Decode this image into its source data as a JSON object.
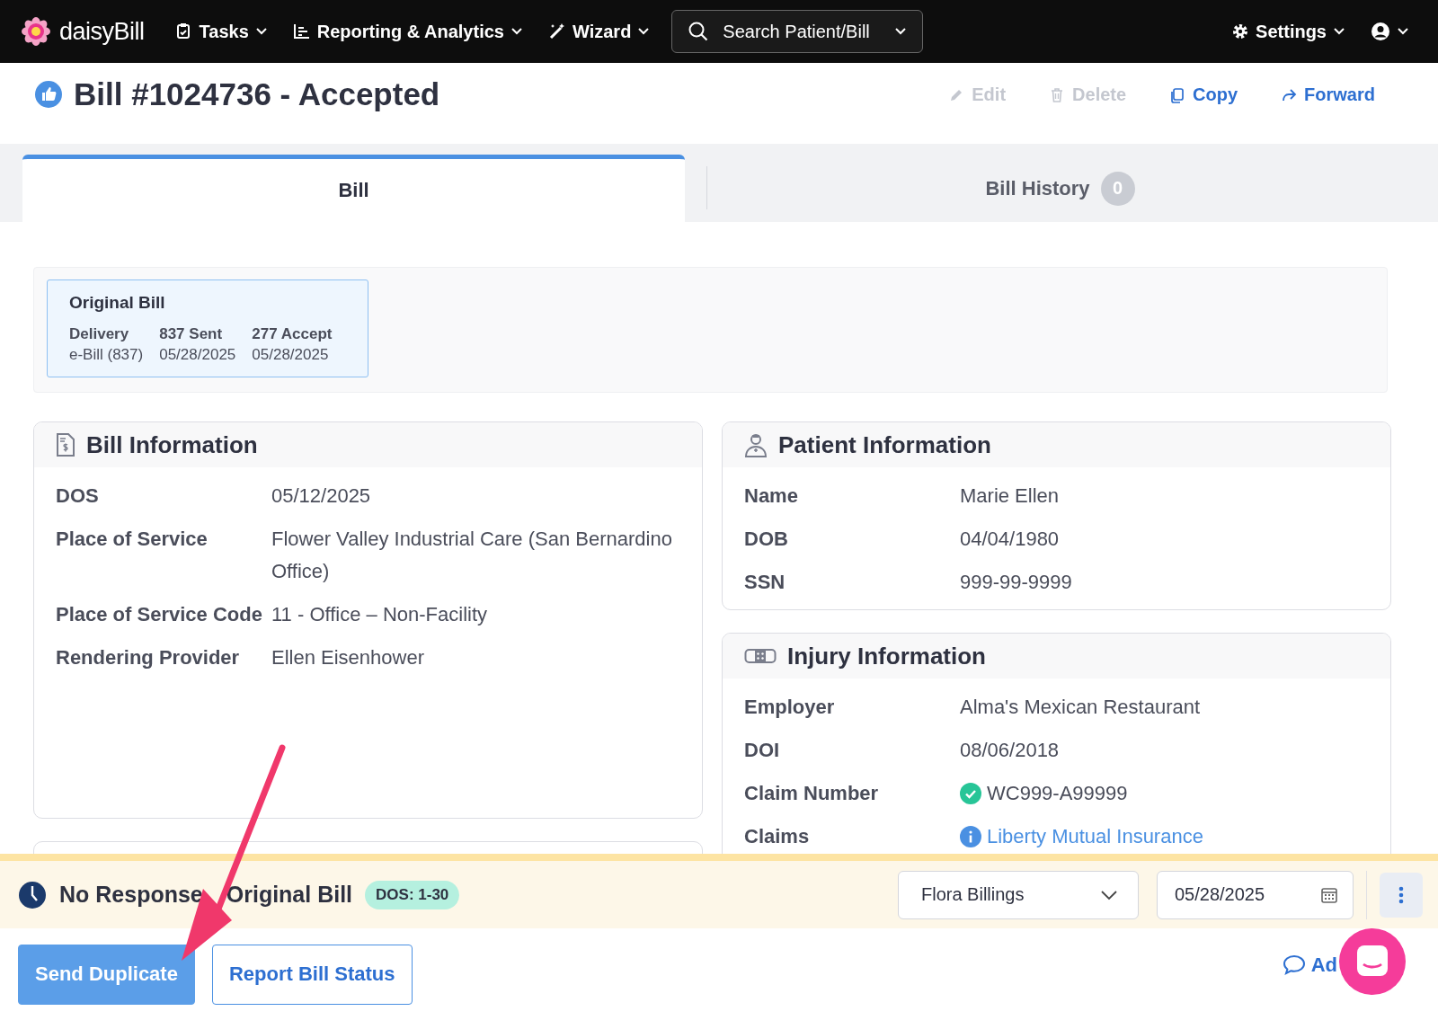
{
  "nav": {
    "logo": "daisyBill",
    "menus": [
      {
        "label": "Tasks",
        "kind": "tasks"
      },
      {
        "label": "Reporting & Analytics",
        "kind": "reports"
      },
      {
        "label": "Wizard",
        "kind": "wizard"
      }
    ],
    "search": {
      "placeholder": "Search Patient/Bill"
    },
    "settings": "Settings"
  },
  "bill_header": {
    "title": "Bill #1024736 - Accepted",
    "actions": [
      {
        "label": "Edit",
        "kind": "edit",
        "disabled": true
      },
      {
        "label": "Delete",
        "kind": "delete",
        "disabled": true
      },
      {
        "label": "Copy",
        "kind": "copy",
        "disabled": false
      },
      {
        "label": "Forward",
        "kind": "forward",
        "disabled": false
      }
    ]
  },
  "tabs": [
    {
      "label": "Bill",
      "selected": true
    },
    {
      "label": "Bill History",
      "selected": false,
      "count": "0"
    }
  ],
  "original_bill": {
    "title": "Original Bill",
    "columns": [
      {
        "heading": "Delivery",
        "value": "e-Bill (837)"
      },
      {
        "heading": "837 Sent",
        "value": "05/28/2025"
      },
      {
        "heading": "277 Accept",
        "value": "05/28/2025"
      }
    ]
  },
  "left_cards": [
    {
      "kind": "bill",
      "title": "Bill Information",
      "rows": [
        {
          "label": "DOS",
          "value": "05/12/2025",
          "kind": "text"
        },
        {
          "label": "Place of Service",
          "value": "Flower Valley Industrial Care (San Bernardino Office)",
          "kind": "text"
        },
        {
          "label": "Place of Service Code",
          "value": "11 - Office – Non-Facility",
          "kind": "text"
        },
        {
          "label": "Rendering Provider",
          "value": "Ellen Eisenhower",
          "kind": "text"
        }
      ]
    }
  ],
  "right_cards": [
    {
      "kind": "patient",
      "title": "Patient Information",
      "rows": [
        {
          "label": "Name",
          "value": "Marie Ellen",
          "kind": "text"
        },
        {
          "label": "DOB",
          "value": "04/04/1980",
          "kind": "text"
        },
        {
          "label": "SSN",
          "value": "999-99-9999",
          "kind": "text"
        }
      ]
    },
    {
      "kind": "injury",
      "title": "Injury Information",
      "rows": [
        {
          "label": "Employer",
          "value": "Alma's Mexican Restaurant",
          "kind": "text"
        },
        {
          "label": "DOI",
          "value": "08/06/2018",
          "kind": "text"
        },
        {
          "label": "Claim Number",
          "value": "WC999-A99999",
          "kind": "verified"
        },
        {
          "label": "Claims",
          "value": "Liberty Mutual Insurance",
          "kind": "link"
        }
      ]
    }
  ],
  "task_bar": {
    "title": [
      "No Response",
      "Original Bill"
    ],
    "badge": "DOS: 1-30",
    "assignee": "Flora Billings",
    "date": "05/28/2025"
  },
  "buttons": [
    {
      "label": "Send Duplicate",
      "primary": true
    },
    {
      "label": "Report Bill Status",
      "primary": false
    }
  ],
  "add_note": "Ad"
}
